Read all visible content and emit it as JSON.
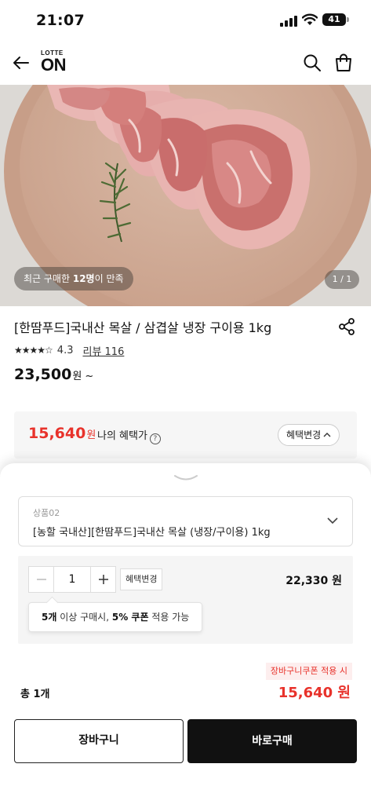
{
  "status_bar": {
    "time": "21:07",
    "battery": "41"
  },
  "header": {
    "logo_top": "LOTTE",
    "logo_main": "ON"
  },
  "gallery": {
    "badge_prefix": "최근 구매한 ",
    "badge_count": "12명",
    "badge_suffix": "이 만족",
    "counter": "1 / 1"
  },
  "product": {
    "title": "[한땀푸드]국내산 목살 / 삼겹살 냉장 구이용 1kg",
    "rating": "4.3",
    "rating_stars": "★★★★☆",
    "review_label": "리뷰 116",
    "price": "23,500",
    "price_unit": "원 ~"
  },
  "benefit": {
    "price": "15,640",
    "price_unit": "원",
    "label": "나의 혜택가",
    "change_button": "혜택변경"
  },
  "sheet": {
    "option_caption": "상품02",
    "option_value": "[농할 국내산][한땀푸드]국내산 목살 (냉장/구이용) 1kg",
    "quantity": "1",
    "item_benefit_button": "혜택변경",
    "item_price": "22,330 원",
    "tooltip_a": "5개",
    "tooltip_b": " 이상 구매시, ",
    "tooltip_c": "5% 쿠폰",
    "tooltip_d": " 적용 가능",
    "coupon_tag": "장바구니쿠폰 적용 시",
    "total_label": "총 1개",
    "total_price": "15,640 원",
    "cart_button": "장바구니",
    "buy_button": "바로구매"
  },
  "colors": {
    "accent_red": "#e8322b",
    "dark": "#111111"
  },
  "icons": [
    "signal-icon",
    "wifi-icon",
    "back-arrow-icon",
    "search-icon",
    "shopping-bag-icon",
    "share-icon",
    "help-icon",
    "chevron-down-icon",
    "minus-icon",
    "plus-icon",
    "sheet-handle-icon"
  ]
}
